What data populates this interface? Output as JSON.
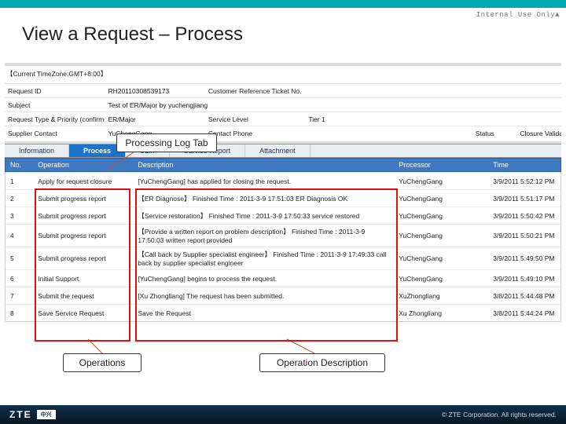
{
  "classification": "Internal Use Only▲",
  "title": "View a Request – Process",
  "timezone": "【Current TimeZone:GMT+8:00】",
  "form": {
    "r1": {
      "l1": "Request ID",
      "v1": "RH20110308539173",
      "l2": "Customer Reference Ticket No.",
      "v2": ""
    },
    "r2": {
      "l1": "Subject",
      "v1": "Test of ER/Major by yuchengjiang",
      "l2": "",
      "v2": ""
    },
    "r3": {
      "l1": "Request Type & Priority (confirmed)",
      "v1": "ER/Major",
      "l2": "Service Level",
      "v2": "Tier 1"
    },
    "r4": {
      "l1": "Supplier Contact",
      "v1": "YuChengGang",
      "l2": "Contact Phone",
      "v2": "",
      "l3": "Status",
      "v3": "Closure Validating"
    }
  },
  "tabs": [
    "Information",
    "Process",
    "SLM",
    "Service Report",
    "Attachment"
  ],
  "log": {
    "headers": [
      "No.",
      "Operation",
      "Description",
      "Processor",
      "Time"
    ],
    "rows": [
      {
        "no": "1",
        "op": "Apply for request closure",
        "desc": "[YuChengGang] has applied for closing the request.",
        "proc": "YuChengGang",
        "time": "3/9/2011 5:52:12 PM"
      },
      {
        "no": "2",
        "op": "Submit progress report",
        "desc": "【ER Diagnose】 Finished Time : 2011-3-9 17:51:03 ER Diagnosis OK",
        "proc": "YuChengGang",
        "time": "3/9/2011 5:51:17 PM"
      },
      {
        "no": "3",
        "op": "Submit progress report",
        "desc": "【Service restoration】 Finished Time : 2011-3-9 17:50:33 service restored",
        "proc": "YuChengGang",
        "time": "3/9/2011 5:50:42 PM"
      },
      {
        "no": "4",
        "op": "Submit progress report",
        "desc": "【Provide a written report on problem description】 Finished Time : 2011-3-9 17:50:03 written report provided",
        "proc": "YuChengGang",
        "time": "3/9/2011 5:50:21 PM"
      },
      {
        "no": "5",
        "op": "Submit progress report",
        "desc": "【Call back by Supplier specialist engineer】 Finished Time : 2011-3-9 17:49:33 call back by supplier specialist engineer",
        "proc": "YuChengGang",
        "time": "3/9/2011 5:49:50 PM"
      },
      {
        "no": "6",
        "op": "Initial Support",
        "desc": "[YuChengGang] begins to process the request.",
        "proc": "YuChengGang",
        "time": "3/9/2011 5:49:10 PM"
      },
      {
        "no": "7",
        "op": "Submit the request",
        "desc": "[Xu Zhongliang] The request has been submitted.",
        "proc": "XuZhongliang",
        "time": "3/8/2011 5:44:48 PM"
      },
      {
        "no": "8",
        "op": "Save Service Request",
        "desc": "Save the Request",
        "proc": "Xu Zhongliang",
        "time": "3/8/2011 5:44:24 PM"
      }
    ]
  },
  "callouts": {
    "tab": "Processing Log Tab",
    "ops": "Operations",
    "desc": "Operation Description"
  },
  "footer": {
    "logo": "ZTE",
    "sub": "中兴",
    "copyright": "© ZTE Corporation. All rights reserved."
  }
}
